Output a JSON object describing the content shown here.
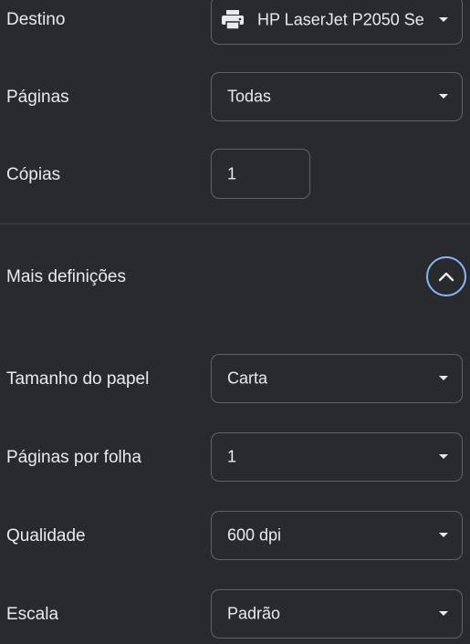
{
  "destination": {
    "label": "Destino",
    "value": "HP LaserJet P2050 Se",
    "icon": "printer-icon"
  },
  "pages": {
    "label": "Páginas",
    "value": "Todas"
  },
  "copies": {
    "label": "Cópias",
    "value": "1"
  },
  "more_settings": {
    "label": "Mais definições",
    "icon": "chevron-up-icon",
    "accent_color": "#8ab4f8"
  },
  "paper_size": {
    "label": "Tamanho do papel",
    "value": "Carta"
  },
  "pages_per_sheet": {
    "label": "Páginas por folha",
    "value": "1"
  },
  "quality": {
    "label": "Qualidade",
    "value": "600 dpi"
  },
  "scale": {
    "label": "Escala",
    "value": "Padrão"
  }
}
